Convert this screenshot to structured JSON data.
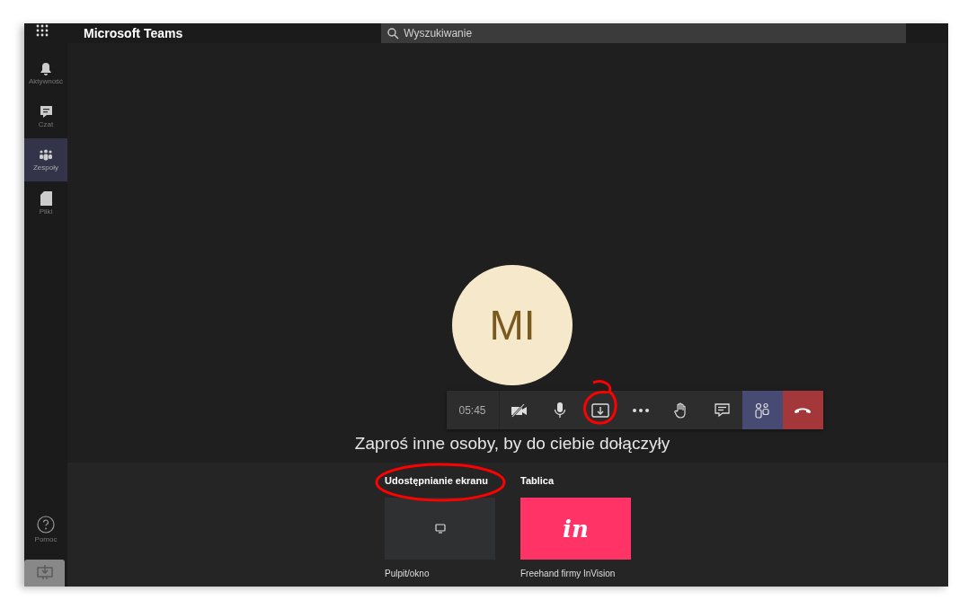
{
  "app": {
    "title": "Microsoft Teams"
  },
  "search": {
    "placeholder": "Wyszukiwanie"
  },
  "sidebar": {
    "items": [
      {
        "label": "Aktywność",
        "kind": "bell",
        "selected": false
      },
      {
        "label": "Czat",
        "kind": "chat",
        "selected": false
      },
      {
        "label": "Zespoły",
        "kind": "teams",
        "selected": true
      },
      {
        "label": "Pliki",
        "kind": "file",
        "selected": false
      }
    ],
    "help": {
      "label": "Pomoc"
    }
  },
  "call": {
    "initials": "MI",
    "timer": "05:45",
    "controls": [
      {
        "kind": "camera-off",
        "selected": false
      },
      {
        "kind": "mic",
        "selected": false
      },
      {
        "kind": "share",
        "selected": false
      },
      {
        "kind": "more",
        "selected": false
      },
      {
        "kind": "hand",
        "selected": false
      },
      {
        "kind": "chat",
        "selected": false
      },
      {
        "kind": "people",
        "selected": true
      },
      {
        "kind": "hangup",
        "selected": false
      }
    ],
    "invite": "Zaproś inne osoby, by do ciebie dołączyły"
  },
  "share_tray": {
    "sections": [
      {
        "title": "Udostępnianie ekranu",
        "kind": "desktop",
        "tile_label": "Pulpit/okno"
      },
      {
        "title": "Tablica",
        "kind": "invision",
        "logo": "in",
        "tile_label": "Freehand firmy InVision"
      }
    ]
  }
}
